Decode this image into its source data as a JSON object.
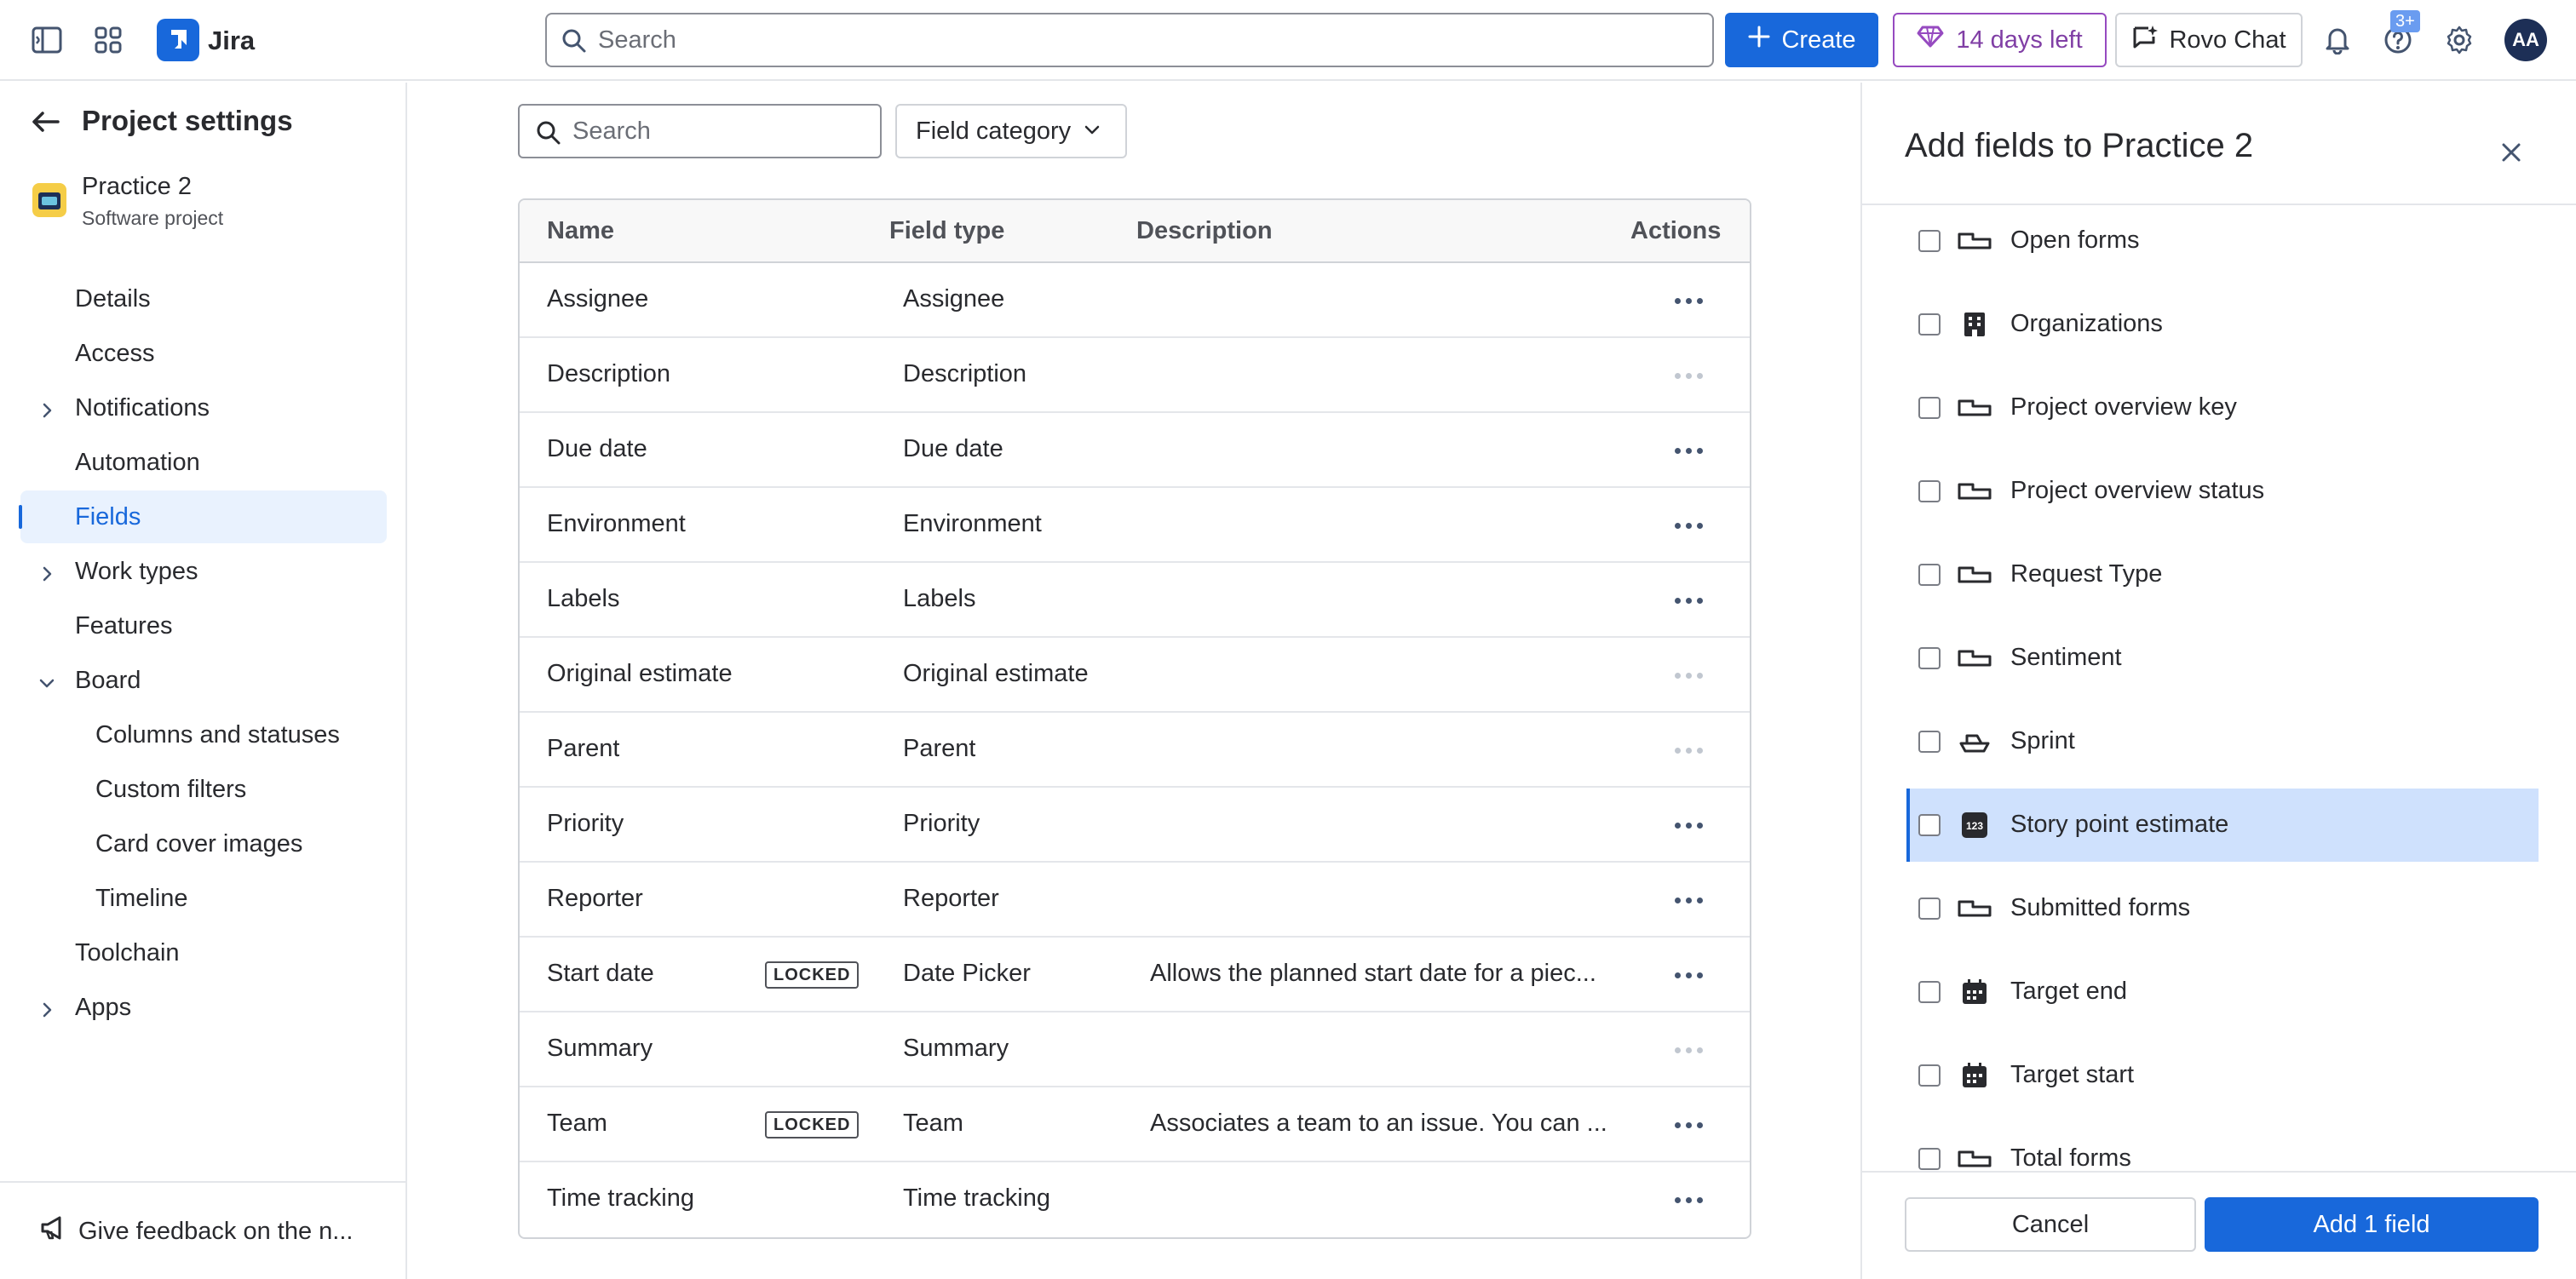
{
  "topbar": {
    "app_name": "Jira",
    "search_placeholder": "Search",
    "create_label": "Create",
    "trial_label": "14 days left",
    "rovo_label": "Rovo Chat",
    "help_badge": "3+",
    "avatar_initials": "AA",
    "icons": [
      "sidebar-toggle-icon",
      "app-switcher-icon",
      "jira-logo-icon",
      "search-icon",
      "plus-icon",
      "gem-icon",
      "rovo-chat-icon",
      "bell-icon",
      "help-icon",
      "gear-icon"
    ]
  },
  "sidebar": {
    "title": "Project settings",
    "project": {
      "name": "Practice 2",
      "type": "Software project"
    },
    "items": [
      {
        "label": "Details"
      },
      {
        "label": "Access"
      },
      {
        "label": "Notifications"
      },
      {
        "label": "Automation"
      },
      {
        "label": "Fields"
      },
      {
        "label": "Work types"
      },
      {
        "label": "Features"
      },
      {
        "label": "Board"
      },
      {
        "label": "Columns and statuses"
      },
      {
        "label": "Custom filters"
      },
      {
        "label": "Card cover images"
      },
      {
        "label": "Timeline"
      },
      {
        "label": "Toolchain"
      },
      {
        "label": "Apps"
      }
    ],
    "active_item": "Fields",
    "feedback_label": "Give feedback on the n..."
  },
  "main": {
    "search_placeholder": "Search",
    "filter_label": "Field category",
    "columns": [
      "Name",
      "Field type",
      "Description",
      "Actions"
    ],
    "locked_label": "LOCKED",
    "rows": [
      {
        "name": "Assignee",
        "type": "Assignee",
        "description": "",
        "locked": false,
        "actions_enabled": true
      },
      {
        "name": "Description",
        "type": "Description",
        "description": "",
        "locked": false,
        "actions_enabled": false
      },
      {
        "name": "Due date",
        "type": "Due date",
        "description": "",
        "locked": false,
        "actions_enabled": true
      },
      {
        "name": "Environment",
        "type": "Environment",
        "description": "",
        "locked": false,
        "actions_enabled": true
      },
      {
        "name": "Labels",
        "type": "Labels",
        "description": "",
        "locked": false,
        "actions_enabled": true
      },
      {
        "name": "Original estimate",
        "type": "Original estimate",
        "description": "",
        "locked": false,
        "actions_enabled": false
      },
      {
        "name": "Parent",
        "type": "Parent",
        "description": "",
        "locked": false,
        "actions_enabled": false
      },
      {
        "name": "Priority",
        "type": "Priority",
        "description": "",
        "locked": false,
        "actions_enabled": true
      },
      {
        "name": "Reporter",
        "type": "Reporter",
        "description": "",
        "locked": false,
        "actions_enabled": true
      },
      {
        "name": "Start date",
        "type": "Date Picker",
        "description": "Allows the planned start date for a piec...",
        "locked": true,
        "actions_enabled": true
      },
      {
        "name": "Summary",
        "type": "Summary",
        "description": "",
        "locked": false,
        "actions_enabled": false
      },
      {
        "name": "Team",
        "type": "Team",
        "description": "Associates a team to an issue. You can ...",
        "locked": true,
        "actions_enabled": true
      },
      {
        "name": "Time tracking",
        "type": "Time tracking",
        "description": "",
        "locked": false,
        "actions_enabled": true
      }
    ]
  },
  "panel": {
    "title": "Add fields to Practice 2",
    "fields": [
      {
        "label": "Open forms",
        "icon": "short-text-field-icon",
        "selected": false
      },
      {
        "label": "Organizations",
        "icon": "organization-building-icon",
        "selected": false
      },
      {
        "label": "Project overview key",
        "icon": "short-text-field-icon",
        "selected": false
      },
      {
        "label": "Project overview status",
        "icon": "short-text-field-icon",
        "selected": false
      },
      {
        "label": "Request Type",
        "icon": "short-text-field-icon",
        "selected": false
      },
      {
        "label": "Sentiment",
        "icon": "short-text-field-icon",
        "selected": false
      },
      {
        "label": "Sprint",
        "icon": "sprint-boat-icon",
        "selected": false
      },
      {
        "label": "Story point estimate",
        "icon": "number-123-icon",
        "selected": true,
        "number_glyph": "123"
      },
      {
        "label": "Submitted forms",
        "icon": "short-text-field-icon",
        "selected": false
      },
      {
        "label": "Target end",
        "icon": "calendar-icon",
        "selected": false
      },
      {
        "label": "Target start",
        "icon": "calendar-icon",
        "selected": false
      },
      {
        "label": "Total forms",
        "icon": "short-text-field-icon",
        "selected": false
      }
    ],
    "cancel_label": "Cancel",
    "add_label": "Add 1 field"
  },
  "colors": {
    "brand_blue": "#1868db",
    "selected_row": "#cfe1fd",
    "active_nav": "#e9f2fe",
    "trial_purple": "#964ac0"
  }
}
